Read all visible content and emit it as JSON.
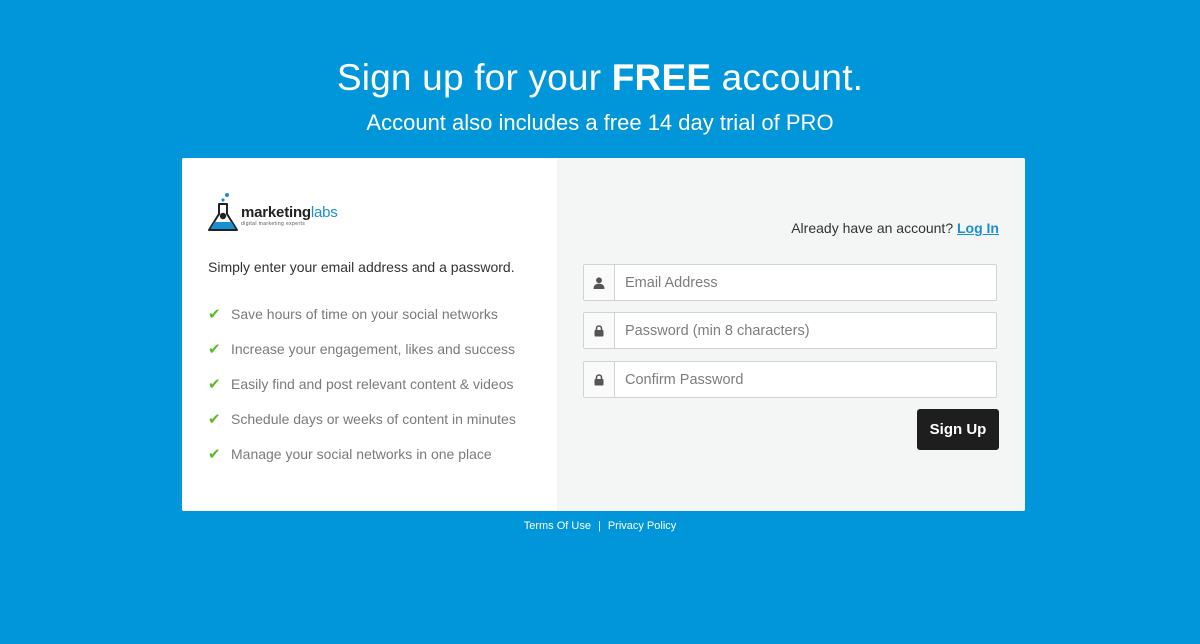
{
  "header": {
    "title_prefix": "Sign up for your ",
    "title_bold": "FREE",
    "title_suffix": " account.",
    "subtitle": "Account also includes a free 14 day trial of PRO"
  },
  "brand": {
    "name_part1": "marketing",
    "name_part2": "labs",
    "tagline": "digital marketing experts",
    "accent_color": "#1a8fd1"
  },
  "left_panel": {
    "intro": "Simply enter your email address and a password.",
    "features": [
      "Save hours of time on your social networks",
      "Increase your engagement, likes and success",
      "Easily find and post relevant content & videos",
      "Schedule days or weeks of content in minutes",
      "Manage your social networks in one place"
    ]
  },
  "form": {
    "account_prompt": "Already have an account?",
    "login_link": "Log In",
    "email_placeholder": "Email Address",
    "password_placeholder": "Password (min 8 characters)",
    "confirm_placeholder": "Confirm Password",
    "submit_label": "Sign Up"
  },
  "footer": {
    "terms": "Terms Of Use",
    "separator": "|",
    "privacy": "Privacy Policy"
  },
  "colors": {
    "background": "#0096d9",
    "check": "#5cb82d",
    "button": "#1e1e1e"
  }
}
